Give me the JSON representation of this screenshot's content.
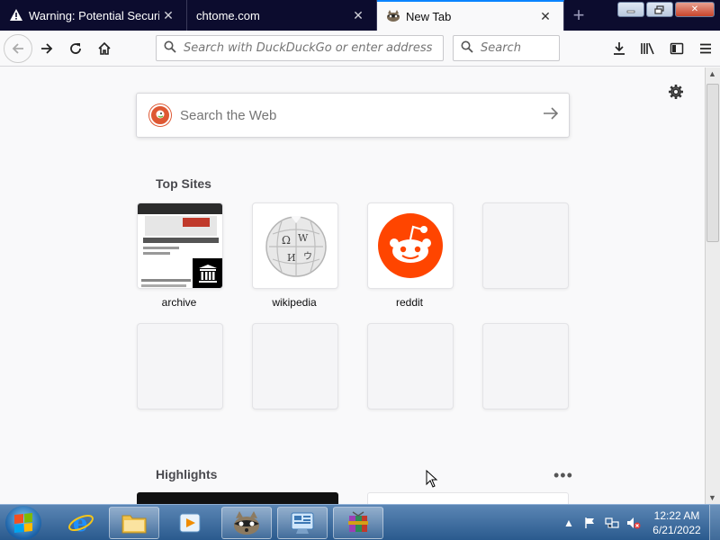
{
  "tabs": [
    {
      "label": "Warning: Potential Security Risk Ahead",
      "icon": "warning-icon",
      "active": false
    },
    {
      "label": "chtome.com",
      "icon": "",
      "active": false
    },
    {
      "label": "New Tab",
      "icon": "raccoon-icon",
      "active": true
    }
  ],
  "toolbar": {
    "url_placeholder": "Search with DuckDuckGo or enter address",
    "search_placeholder": "Search"
  },
  "newtab": {
    "web_search_placeholder": "Search the Web",
    "top_sites_title": "Top Sites",
    "top_sites": [
      {
        "label": "archive"
      },
      {
        "label": "wikipedia"
      },
      {
        "label": "reddit"
      }
    ],
    "highlights_title": "Highlights"
  },
  "taskbar": {
    "time": "12:22 AM",
    "date": "6/21/2022"
  },
  "colors": {
    "accent": "#0a84ff",
    "reddit": "#ff4500",
    "duckduckgo": "#de5833",
    "tab_strip": "#0c0c2e"
  }
}
